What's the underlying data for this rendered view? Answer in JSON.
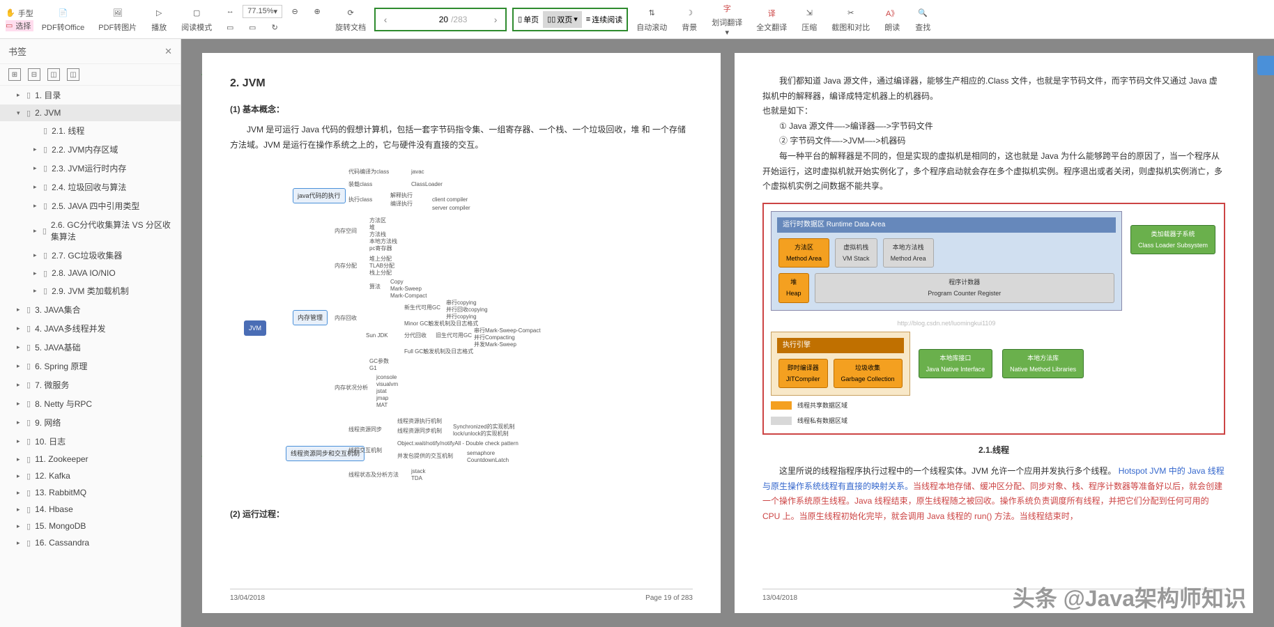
{
  "toolbar": {
    "hand": "手型",
    "select": "选择",
    "pdf_office": "PDF转Office",
    "pdf_image": "PDF转图片",
    "play": "播放",
    "read_mode": "阅读模式",
    "zoom_value": "77.15%",
    "rotate": "旋转文档",
    "page_current": "20",
    "page_total": "/283",
    "single": "单页",
    "double": "双页",
    "continuous": "连续阅读",
    "auto_scroll": "自动滚动",
    "background": "背景",
    "word_trans": "划词翻译",
    "full_trans": "全文翻译",
    "compress": "压缩",
    "crop_compare": "截图和对比",
    "read_aloud": "朗读",
    "find": "查找"
  },
  "sidebar": {
    "title": "书签",
    "items": [
      {
        "label": "1. 目录",
        "expand": "▸"
      },
      {
        "label": "2. JVM",
        "expand": "▾",
        "active": true
      },
      {
        "label": "2.1. 线程",
        "sub": true
      },
      {
        "label": "2.2. JVM内存区域",
        "sub": true,
        "expand": "▸"
      },
      {
        "label": "2.3. JVM运行时内存",
        "sub": true,
        "expand": "▸"
      },
      {
        "label": "2.4. 垃圾回收与算法",
        "sub": true,
        "expand": "▸"
      },
      {
        "label": "2.5. JAVA 四中引用类型",
        "sub": true,
        "expand": "▸"
      },
      {
        "label": "2.6. GC分代收集算法  VS 分区收集算法",
        "sub": true,
        "expand": "▸"
      },
      {
        "label": "2.7. GC垃圾收集器",
        "sub": true,
        "expand": "▸"
      },
      {
        "label": "2.8.  JAVA IO/NIO",
        "sub": true,
        "expand": "▸"
      },
      {
        "label": "2.9. JVM 类加载机制",
        "sub": true,
        "expand": "▸"
      },
      {
        "label": "3. JAVA集合",
        "expand": "▸"
      },
      {
        "label": "4. JAVA多线程并发",
        "expand": "▸"
      },
      {
        "label": "5. JAVA基础",
        "expand": "▸"
      },
      {
        "label": "6. Spring 原理",
        "expand": "▸"
      },
      {
        "label": "7.  微服务",
        "expand": "▸"
      },
      {
        "label": "8. Netty 与RPC",
        "expand": "▸"
      },
      {
        "label": "9. 网络",
        "expand": "▸"
      },
      {
        "label": "10. 日志",
        "expand": "▸"
      },
      {
        "label": "11. Zookeeper",
        "expand": "▸"
      },
      {
        "label": "12. Kafka",
        "expand": "▸"
      },
      {
        "label": "13. RabbitMQ",
        "expand": "▸"
      },
      {
        "label": "14. Hbase",
        "expand": "▸"
      },
      {
        "label": "15. MongoDB",
        "expand": "▸"
      },
      {
        "label": "16. Cassandra",
        "expand": "▸"
      }
    ]
  },
  "page_left": {
    "title": "2. JVM",
    "h1": "(1) 基本概念：",
    "p1": "JVM 是可运行 Java 代码的假想计算机，包括一套字节码指令集、一组寄存器、一个栈、一个垃圾回收，堆 和 一个存储方法域。JVM 是运行在操作系统之上的，它与硬件没有直接的交互。",
    "h2": "(2) 运行过程：",
    "footer_date": "13/04/2018",
    "footer_page": "Page 19 of 283",
    "mindmap": {
      "root": "JVM",
      "b1": "java代码的执行",
      "b1_1": "代码编译为class",
      "b1_1v": "javac",
      "b1_2": "装载class",
      "b1_2v": "ClassLoader",
      "b1_3": "执行class",
      "b1_3a": "解释执行",
      "b1_3b": "编译执行",
      "b1_3b1": "client compiler",
      "b1_3b2": "server compiler",
      "b2": "内存管理",
      "b2_1": "内存空间",
      "b2_1a": "方法区",
      "b2_1b": "堆",
      "b2_1c": "方法栈",
      "b2_1d": "本地方法栈",
      "b2_1e": "pc寄存器",
      "b2_2": "内存分配",
      "b2_2a": "堆上分配",
      "b2_2b": "TLAB分配",
      "b2_2c": "栈上分配",
      "b2_3": "内存回收",
      "b2_3a": "算法",
      "b2_3a1": "Copy",
      "b2_3a2": "Mark-Sweep",
      "b2_3a3": "Mark-Compact",
      "b2_3b": "Sun JDK",
      "b2_3b1": "新生代可用GC",
      "b2_3b1a": "串行copying",
      "b2_3b1b": "并行回收copying",
      "b2_3b1c": "并行copying",
      "b2_3b2": "Minor GC触发机制及日志格式",
      "b2_3b3": "分代回收",
      "b2_3b3a": "旧生代可用GC",
      "b2_3b3a1": "串行Mark-Sweep-Compact",
      "b2_3b3a2": "并行Compacting",
      "b2_3b3a3": "并发Mark-Sweep",
      "b2_3b4": "Full GC触发机制及日志格式",
      "b2_3c": "GC参数",
      "b2_3d": "G1",
      "b2_4": "内存状况分析",
      "b2_4a": "jconsole",
      "b2_4b": "visualvm",
      "b2_4c": "jstat",
      "b2_4d": "jmap",
      "b2_4e": "MAT",
      "b3": "线程资源同步和交互机制",
      "b3_1": "线程资源同步",
      "b3_1a": "线程资源执行机制",
      "b3_1b": "线程资源同步机制",
      "b3_1b1": "Synchronized的实现机制",
      "b3_1b2": "lock/unlock的实现机制",
      "b3_2": "线程交互机制",
      "b3_2a": "Object.wait/notify/notifyAll - Double check pattern",
      "b3_2b": "并发包提供的交互机制",
      "b3_2b1": "semaphore",
      "b3_2b2": "CountdownLatch",
      "b3_3": "线程状态及分析方法",
      "b3_3a": "jstack",
      "b3_3b": "TDA"
    }
  },
  "page_right": {
    "p1": "我们都知道 Java 源文件，通过编译器，能够生产相应的.Class 文件，也就是字节码文件，而字节码文件又通过 Java 虚拟机中的解释器，编译成特定机器上的机器码。",
    "p2": "也就是如下：",
    "p3": "① Java 源文件—->编译器—->字节码文件",
    "p4": "② 字节码文件—->JVM—->机器码",
    "p5": "每一种平台的解释器是不同的，但是实现的虚拟机是相同的，这也就是 Java 为什么能够跨平台的原因了，当一个程序从开始运行，这时虚拟机就开始实例化了，多个程序启动就会存在多个虚拟机实例。程序退出或者关闭，则虚拟机实例消亡，多个虚拟机实例之间数据不能共享。",
    "diagram": {
      "runtime_title": "运行时数据区  Runtime Data Area",
      "method_area": "方法区\nMethod Area",
      "vm_stack": "虚拟机栈\nVM Stack",
      "native_method": "本地方法栈\nMethod Area",
      "heap": "堆\nHeap",
      "pcr": "程序计数器\nProgram Counter Register",
      "classloader": "类加载器子系统\nClass Loader Subsystem",
      "exec_title": "执行引擎",
      "jit": "即时编译器\nJITCompiler",
      "gc": "垃圾收集\nGarbage Collection",
      "jni": "本地库接口\nJava Native Interface",
      "native_lib": "本地方法库\nNative Method Libraries",
      "legend1": "线程共享数据区域",
      "legend2": "线程私有数据区域",
      "watermark_url": "http://blog.csdn.net/luomingkui1109"
    },
    "h21": "2.1.线程",
    "p6a": "这里所说的线程指程序执行过程中的一个线程实体。JVM 允许一个应用并发执行多个线程。",
    "p6b": "Hotspot JVM 中的 Java 线程与原生操作系统线程有直接的映射关系。",
    "p6c": "当线程本地存储、缓冲区分配、同步对象、栈、程序计数器等准备好以后，就会创建一个操作系统原生线程。Java 线程结束，原生线程随之被回收。操作系统负责调度所有线程，并把它们分配到任何可用的 CPU 上。当原生线程初始化完毕，就会调用 Java 线程的 run() 方法。当线程结束时，",
    "footer_date": "13/04/2018"
  },
  "watermark": "头条 @Java架构师知识"
}
